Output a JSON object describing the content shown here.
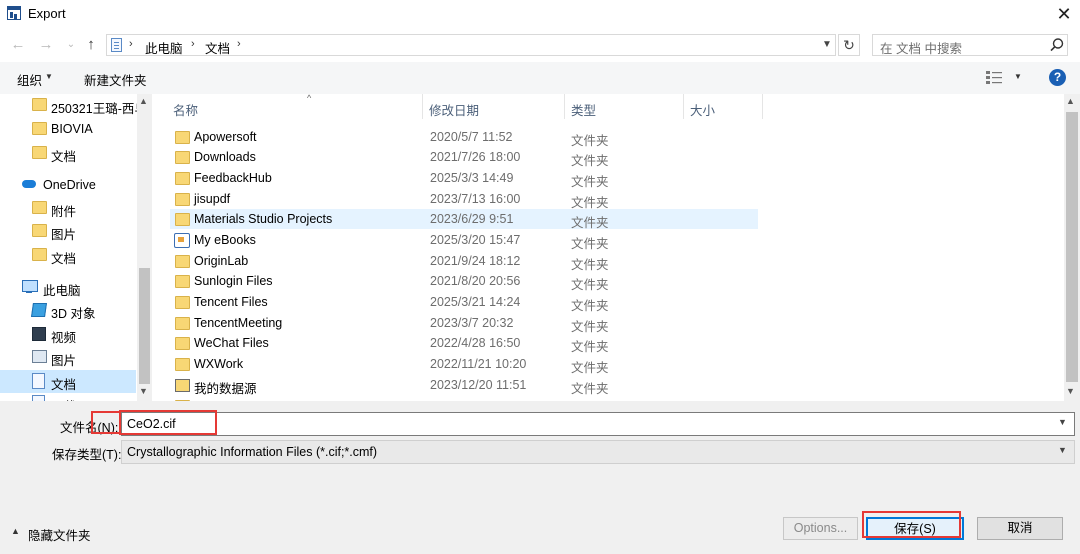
{
  "window": {
    "title": "Export",
    "close_glyph": "✕"
  },
  "nav": {
    "back_glyph": "←",
    "forward_glyph": "→",
    "recent_glyph": "⌄",
    "up_glyph": "↑"
  },
  "address": {
    "sep": "›",
    "crumbs": [
      "此电脑",
      "文档"
    ],
    "search_placeholder": "在 文档 中搜索"
  },
  "toolbar": {
    "organize": "组织",
    "new_folder": "新建文件夹",
    "help": "?"
  },
  "sidebar": {
    "items": [
      {
        "label": "250321王璐-西乌",
        "icon": "folder-icon"
      },
      {
        "label": "BIOVIA",
        "icon": "folder-icon"
      },
      {
        "label": "文档",
        "icon": "folder-icon"
      },
      {
        "label": "OneDrive",
        "icon": "cloud-icon"
      },
      {
        "label": "附件",
        "icon": "folder-icon"
      },
      {
        "label": "图片",
        "icon": "folder-icon"
      },
      {
        "label": "文档",
        "icon": "folder-icon"
      },
      {
        "label": "此电脑",
        "icon": "computer-icon"
      },
      {
        "label": "3D 对象",
        "icon": "cube-icon"
      },
      {
        "label": "视频",
        "icon": "video-icon"
      },
      {
        "label": "图片",
        "icon": "pictures-icon"
      },
      {
        "label": "文档",
        "icon": "documents-icon",
        "selected": true
      },
      {
        "label": "下载",
        "icon": "download-icon"
      }
    ]
  },
  "filelist": {
    "columns": [
      "名称",
      "修改日期",
      "类型",
      "大小"
    ],
    "rows": [
      {
        "name": "Apowersoft",
        "date": "2020/5/7 11:52",
        "type": "文件夹",
        "icon": "folder-icon"
      },
      {
        "name": "Downloads",
        "date": "2021/7/26 18:00",
        "type": "文件夹",
        "icon": "folder-icon"
      },
      {
        "name": "FeedbackHub",
        "date": "2025/3/3 14:49",
        "type": "文件夹",
        "icon": "folder-icon"
      },
      {
        "name": "jisupdf",
        "date": "2023/7/13 16:00",
        "type": "文件夹",
        "icon": "folder-icon"
      },
      {
        "name": "Materials Studio Projects",
        "date": "2023/6/29 9:51",
        "type": "文件夹",
        "icon": "folder-icon",
        "hovered": true
      },
      {
        "name": "My eBooks",
        "date": "2025/3/20 15:47",
        "type": "文件夹",
        "icon": "ebook-icon"
      },
      {
        "name": "OriginLab",
        "date": "2021/9/24 18:12",
        "type": "文件夹",
        "icon": "folder-icon"
      },
      {
        "name": "Sunlogin Files",
        "date": "2021/8/20 20:56",
        "type": "文件夹",
        "icon": "folder-icon"
      },
      {
        "name": "Tencent Files",
        "date": "2025/3/21 14:24",
        "type": "文件夹",
        "icon": "folder-icon"
      },
      {
        "name": "TencentMeeting",
        "date": "2023/3/7 20:32",
        "type": "文件夹",
        "icon": "folder-icon"
      },
      {
        "name": "WeChat Files",
        "date": "2022/4/28 16:50",
        "type": "文件夹",
        "icon": "folder-icon"
      },
      {
        "name": "WXWork",
        "date": "2022/11/21 10:20",
        "type": "文件夹",
        "icon": "folder-icon"
      },
      {
        "name": "我的数据源",
        "date": "2023/12/20 11:51",
        "type": "文件夹",
        "icon": "datasource-icon"
      },
      {
        "name": "",
        "date": "",
        "type": "文件夹",
        "icon": "folder-icon"
      }
    ]
  },
  "form": {
    "filename_label": "文件名(N):",
    "filename_value": "CeO2.cif",
    "filetype_label": "保存类型(T):",
    "filetype_value": "Crystallographic Information Files (*.cif;*.cmf)",
    "hide_folders": "隐藏文件夹",
    "options_button": "Options...",
    "save_button": "保存(S)",
    "cancel_button": "取消"
  },
  "colors": {
    "accent": "#0078d7",
    "highlight_box": "#e53935",
    "selection": "#cce8ff"
  }
}
